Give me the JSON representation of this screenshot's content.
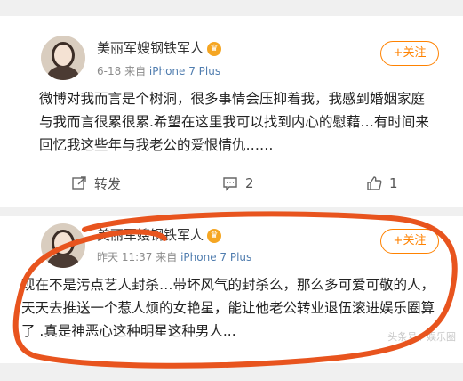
{
  "posts": [
    {
      "user_name": "美丽军嫂钢铁军人",
      "time": "6-18",
      "source_prefix": "来自",
      "source": "iPhone 7 Plus",
      "follow_label": "+关注",
      "text": "微博对我而言是个树洞，很多事情会压抑着我，我感到婚姻家庭与我而言很累很累.希望在这里我可以找到内心的慰藉…有时间来回忆我这些年与我老公的爱恨情仇……",
      "repost_label": "转发",
      "comment_count": "2",
      "like_count": "1"
    },
    {
      "user_name": "美丽军嫂钢铁军人",
      "time": "昨天 11:37",
      "source_prefix": "来自",
      "source": "iPhone 7 Plus",
      "follow_label": "+关注",
      "text": "现在不是污点艺人封杀…带坏风气的封杀么，那么多可爱可敬的人，天天去推送一个惹人烦的女艳星，能让他老公转业退伍滚进娱乐圈算了 .真是神恶心这种明星这种男人..."
    }
  ],
  "watermark": "头条号 / 娱乐圈",
  "colors": {
    "accent": "#ff8200",
    "link": "#507daf",
    "annotation": "#e8541e"
  }
}
